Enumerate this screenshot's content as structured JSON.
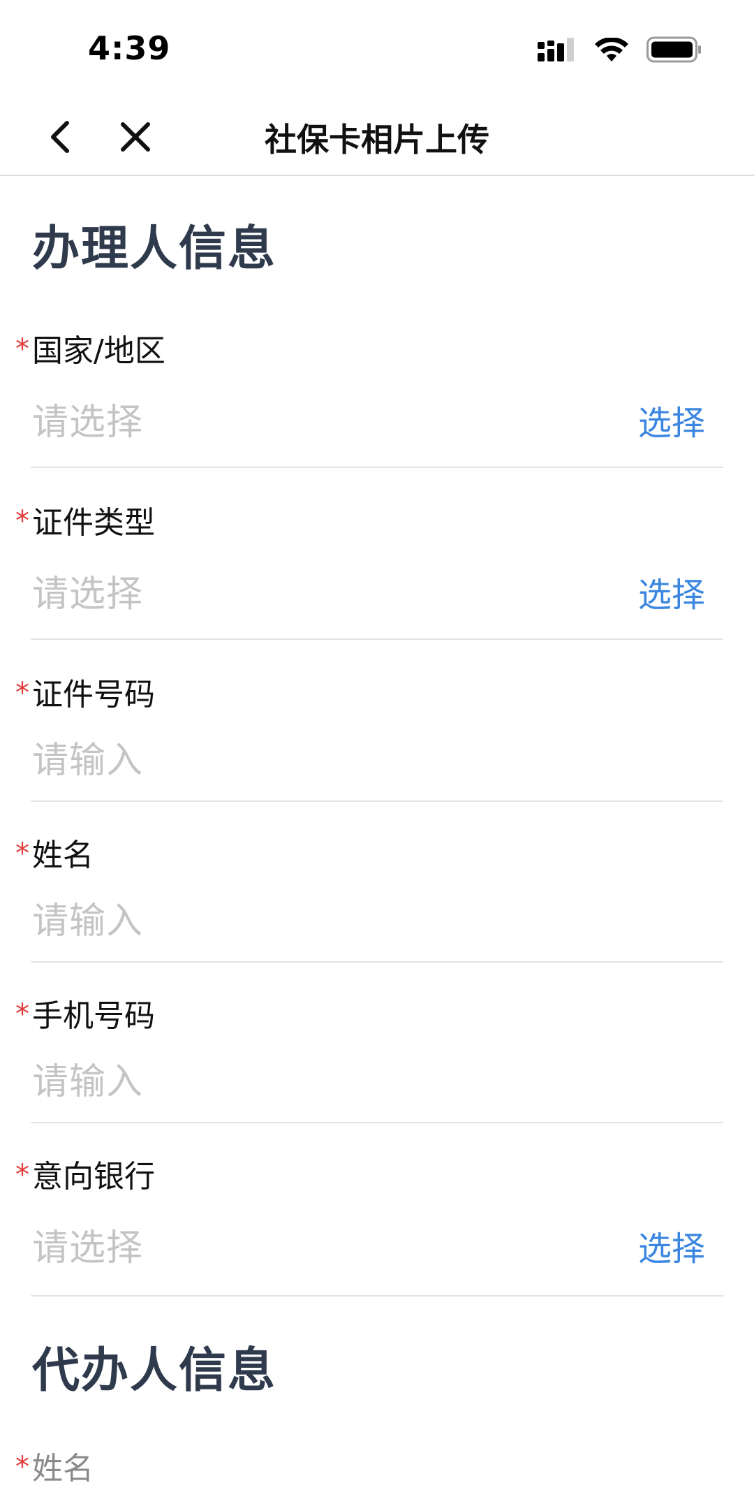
{
  "status_bar": {
    "time": "4:39",
    "icons": [
      "signal-icon",
      "wifi-icon",
      "battery-icon"
    ]
  },
  "nav": {
    "title": "社保卡相片上传",
    "back_icon": "chevron-left-icon",
    "close_icon": "close-icon"
  },
  "sections": {
    "applicant": {
      "title": "办理人信息",
      "fields": [
        {
          "label": "国家/地区",
          "required": "*",
          "placeholder": "请选择",
          "action": "选择"
        },
        {
          "label": "证件类型",
          "required": "*",
          "placeholder": "请选择",
          "action": "选择"
        },
        {
          "label": "证件号码",
          "required": "*",
          "placeholder": "请输入"
        },
        {
          "label": "姓名",
          "required": "*",
          "placeholder": "请输入"
        },
        {
          "label": "手机号码",
          "required": "*",
          "placeholder": "请输入"
        },
        {
          "label": "意向银行",
          "required": "*",
          "placeholder": "请选择",
          "action": "选择"
        }
      ]
    },
    "agent": {
      "title": "代办人信息",
      "fields": [
        {
          "label": "姓名",
          "required": "*"
        }
      ]
    }
  },
  "colors": {
    "required": "#e23b3b",
    "action": "#3b86e0",
    "section_title": "#2f3a4c",
    "placeholder": "#c4c4c4"
  }
}
